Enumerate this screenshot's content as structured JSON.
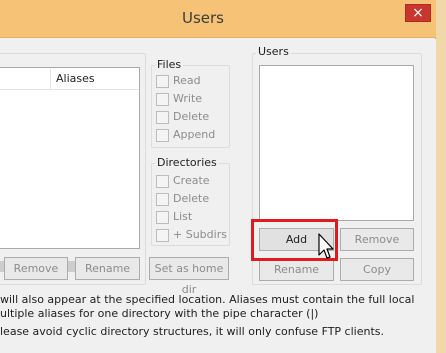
{
  "window": {
    "title": "Users",
    "close_glyph": "×"
  },
  "directory_list": {
    "columns": [
      "",
      "Aliases"
    ],
    "scroll_right_glyph": "›"
  },
  "files_group": {
    "label": "Files",
    "items": [
      "Read",
      "Write",
      "Delete",
      "Append"
    ]
  },
  "directories_group": {
    "label": "Directories",
    "items": [
      "Create",
      "Delete",
      "List",
      "+ Subdirs"
    ]
  },
  "users_group": {
    "label": "Users"
  },
  "dir_buttons": {
    "remove": "Remove",
    "rename": "Rename",
    "set_home": "Set as home dir"
  },
  "user_buttons": {
    "add": "Add",
    "remove": "Remove",
    "rename": "Rename",
    "copy": "Copy"
  },
  "notes": {
    "line1": "will also appear at the specified location. Aliases must contain the full local",
    "line2": "ultiple aliases for one directory with the pipe character (|)",
    "line3": "lease avoid cyclic directory structures, it will only confuse FTP clients."
  },
  "colors": {
    "titlebar": "#f5c276",
    "close_button": "#c8372d",
    "highlight": "#e01b1b"
  }
}
